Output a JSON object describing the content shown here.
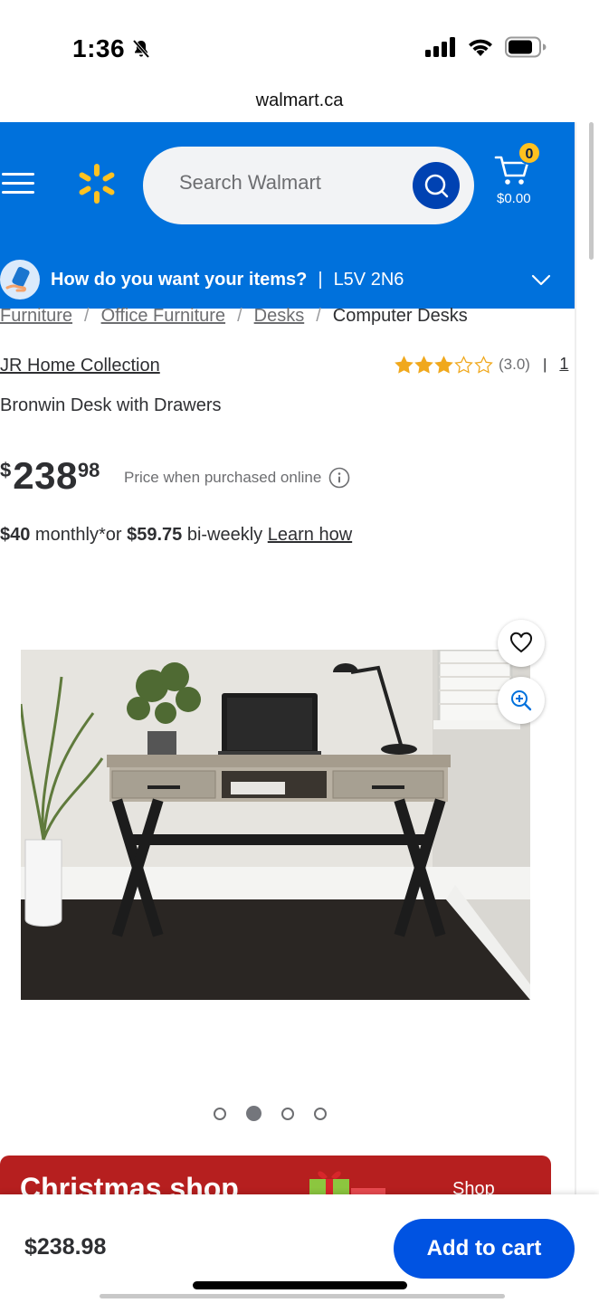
{
  "status_bar": {
    "time": "1:36"
  },
  "browser": {
    "url": "walmart.ca"
  },
  "header": {
    "search_placeholder": "Search Walmart",
    "cart_count": "0",
    "cart_total": "$0.00",
    "delivery_question": "How do you want your items?",
    "delivery_separator": "|",
    "postal_code": "L5V 2N6"
  },
  "breadcrumb": [
    "Furniture",
    "Office Furniture",
    "Desks",
    "Computer Desks"
  ],
  "product": {
    "brand": "JR Home Collection",
    "rating_value": 3,
    "rating_max": 5,
    "rating_text": "(3.0)",
    "rating_separator": "|",
    "review_count": "1",
    "title": "Bronwin Desk with Drawers",
    "price_currency": "$",
    "price_dollars": "238",
    "price_cents": "98",
    "price_note": "Price when purchased online",
    "monthly_amount": "$40",
    "monthly_text": " monthly*or ",
    "biweekly_amount": "$59.75",
    "biweekly_text": " bi-weekly ",
    "learn_how": "Learn how"
  },
  "gallery": {
    "count": 4,
    "active_index": 1
  },
  "promo": {
    "title": "Christmas shop",
    "link": "Shop"
  },
  "bottom_bar": {
    "price": "$238.98",
    "add_to_cart": "Add to cart"
  },
  "colors": {
    "brand_blue": "#0071dc",
    "spark_yellow": "#ffc220",
    "button_blue": "#0053e2",
    "promo_red": "#b61f1f",
    "star": "#f0a81c"
  }
}
